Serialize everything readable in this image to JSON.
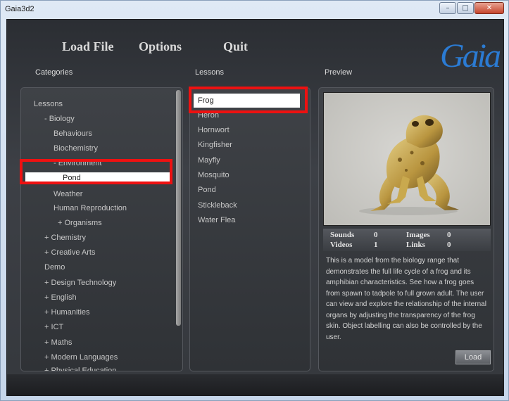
{
  "window": {
    "title": "Gaia3d2",
    "minimize": "–",
    "maximize": "□",
    "close": "✕"
  },
  "menu": {
    "load_file": "Load File",
    "options": "Options",
    "quit": "Quit"
  },
  "logo": {
    "text": "Gaia",
    "color": "#2b7bd3"
  },
  "columns": {
    "categories": "Categories",
    "lessons": "Lessons",
    "preview": "Preview"
  },
  "categories": {
    "items": [
      {
        "label": "Lessons",
        "level": 0
      },
      {
        "label": "- Biology",
        "level": 1
      },
      {
        "label": "Behaviours",
        "level": 2
      },
      {
        "label": "Biochemistry",
        "level": 2
      },
      {
        "label": "- Environment",
        "level": 2
      },
      {
        "label": "Pond",
        "level": 3,
        "selected": true
      },
      {
        "label": "Weather",
        "level": 2
      },
      {
        "label": "Human Reproduction",
        "level": 2
      },
      {
        "label": "+ Organisms",
        "level": 2
      },
      {
        "label": "+ Chemistry",
        "level": 1
      },
      {
        "label": "+ Creative Arts",
        "level": 1
      },
      {
        "label": "Demo",
        "level": 1
      },
      {
        "label": "+ Design Technology",
        "level": 1
      },
      {
        "label": "+ English",
        "level": 1
      },
      {
        "label": "+ Humanities",
        "level": 1
      },
      {
        "label": "+ ICT",
        "level": 1
      },
      {
        "label": "+ Maths",
        "level": 1
      },
      {
        "label": "+ Modern Languages",
        "level": 1
      },
      {
        "label": "+ Physical Education",
        "level": 1
      }
    ]
  },
  "lessons": {
    "items": [
      {
        "label": "Frog",
        "selected": true
      },
      {
        "label": "Heron"
      },
      {
        "label": "Hornwort"
      },
      {
        "label": "Kingfisher"
      },
      {
        "label": "Mayfly"
      },
      {
        "label": "Mosquito"
      },
      {
        "label": "Pond"
      },
      {
        "label": "Stickleback"
      },
      {
        "label": "Water Flea"
      }
    ]
  },
  "preview": {
    "stats": {
      "sounds_label": "Sounds",
      "sounds_value": "0",
      "images_label": "Images",
      "images_value": "0",
      "videos_label": "Videos",
      "videos_value": "1",
      "links_label": "Links",
      "links_value": "0"
    },
    "description": "This is a model from the biology range that demonstrates the full life cycle of a frog and its amphibian characteristics. See how a frog goes from spawn to tadpole to full grown adult. The user can view and explore the relationship of the internal organs by adjusting the transparency of the frog skin. Object labelling can also be controlled by the user.",
    "load_button": "Load"
  },
  "highlight_color": "#ee1111"
}
